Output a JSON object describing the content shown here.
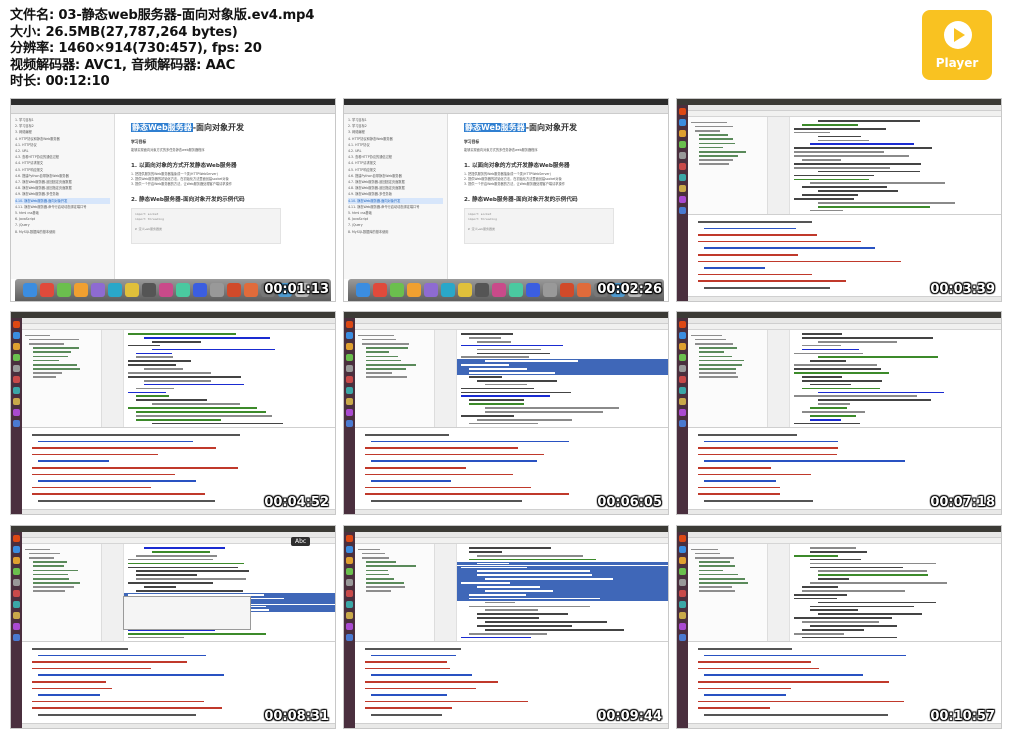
{
  "info": {
    "filename": "文件名: 03-静态web服务器-面向对象版.ev4.mp4",
    "size": "大小: 26.5MB(27,787,264 bytes)",
    "resolution": "分辨率: 1460×914(730:457), fps: 20",
    "codec": "视频解码器: AVC1, 音频解码器: AAC",
    "duration": "时长: 00:12:10"
  },
  "logo": {
    "text": "Player",
    "color": "#f9c221"
  },
  "browser_page": {
    "title_highlight": "静态Web服务器",
    "title_rest": "-面向对象开发",
    "subtitle": "学习目标",
    "objective": "能够实现面向对象方式的多任务静态web服务器程序",
    "section1": "1. 以面向对象的方式开发静态Web服务器",
    "steps": [
      "1. 把提供服务的Web服务器抽象成一个类(HTTPWebServer)",
      "2. 提供Web服务器的初始化方法，在初始化方法里面创建socket对象",
      "3. 提供一个开启Web服务器的方法，让Web服务器处理客户端请求操作"
    ],
    "section2": "2. 静态Web服务器-面向对象开发的示例代码",
    "code": [
      "import socket",
      "import threading",
      "",
      "# 定义web服务器类"
    ],
    "sidebar": [
      "1. 学习目标1",
      "2. 学习目标2",
      "3. 网络编程",
      "4. HTTP协议和静态Web服务器",
      "4.1. HTTP协议",
      "4.2. URL",
      "4.3. 查看HTTP协议的通信过程",
      "4.4. HTTP请求报文",
      "4.5. HTTP响应报文",
      "4.6. 搭建Python自带静态Web服务器",
      "4.7. 静态Web服务器-返回固定页面数据",
      "4.8. 静态Web服务器-返回指定页面数据",
      "4.9. 静态Web服务器-多任务版",
      "4.10. 静态Web服务器-面向对象开发",
      "4.11. 静态Web服务器-命令行启动动态绑定端口号",
      "5. html css基础",
      "6. JavaScript",
      "7. jQuery",
      "8. MySQL数据库的基本使用"
    ],
    "sidebar_selected": 13
  },
  "ide": {
    "tooltip": "Abc"
  },
  "thumbnails": [
    {
      "type": "browser",
      "timestamp": "00:01:13"
    },
    {
      "type": "browser",
      "timestamp": "00:02:26"
    },
    {
      "type": "ide",
      "timestamp": "00:03:39"
    },
    {
      "type": "ide",
      "timestamp": "00:04:52"
    },
    {
      "type": "ide",
      "timestamp": "00:06:05"
    },
    {
      "type": "ide",
      "timestamp": "00:07:18"
    },
    {
      "type": "ide",
      "timestamp": "00:08:31"
    },
    {
      "type": "ide",
      "timestamp": "00:09:44"
    },
    {
      "type": "ide",
      "timestamp": "00:10:57"
    }
  ],
  "colors": {
    "keyword": "#1a2bd1",
    "string": "#3c8a2a",
    "comment": "#8a8a8a",
    "code": "#444444",
    "selection": "#3f67b8",
    "terminal_error": "#c0392b",
    "terminal_link": "#2952c2",
    "launcher": "#4a2f3e"
  }
}
